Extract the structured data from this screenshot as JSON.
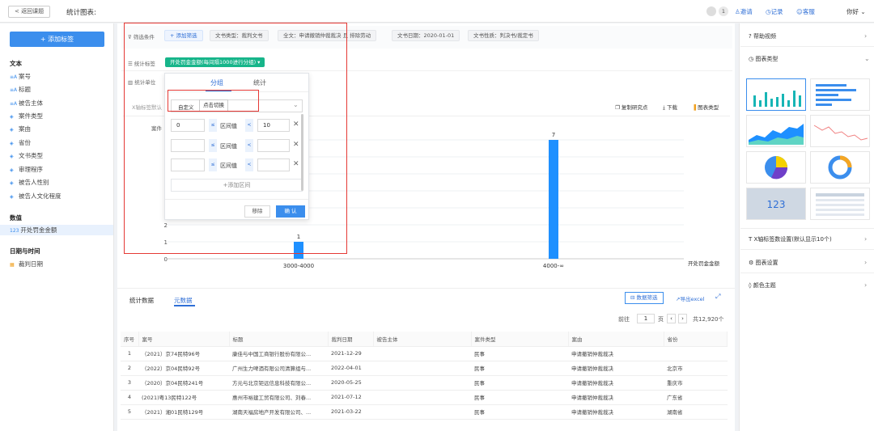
{
  "topbar": {
    "back_label": "< 返回课题",
    "title": "统计图表:",
    "badge_count": "1",
    "invite": "邀请",
    "record": "记录",
    "service": "客服",
    "user": "你好"
  },
  "sidebar": {
    "add_label": "+ 添加标签",
    "groups": [
      {
        "title": "文本",
        "items": [
          "案号",
          "标题",
          "被告主体",
          "案件类型",
          "案由",
          "省份",
          "文书类型",
          "审理程序",
          "被告人性别",
          "被告人文化程度"
        ]
      },
      {
        "title": "数值",
        "items": [
          "开处罚金金额"
        ]
      },
      {
        "title": "日期与时间",
        "items": [
          "裁判日期"
        ]
      }
    ]
  },
  "filters": {
    "label": "筛选条件",
    "add": "+ 添加筛选",
    "chips": [
      "文书类型：裁判文书",
      "全文：申请撤销仲裁裁决 且 排除劳动",
      "文书日期：2020-01-01",
      "文书性质：判决书/裁定书"
    ]
  },
  "stat": {
    "tag_label": "统计标签",
    "tag_value": "开处罚金金额(每间隔1000进行分组) ▾",
    "unit_label": "统计单位",
    "x_label": "X轴标签默认"
  },
  "popover": {
    "tab_group": "分组",
    "tab_stat": "统计",
    "custom": "自定义",
    "click_switch": "点击切换",
    "range_text": "区间值",
    "rows": [
      {
        "from": "0",
        "to": "10"
      },
      {
        "from": "",
        "to": ""
      },
      {
        "from": "",
        "to": ""
      }
    ],
    "add_range": "+添加区间",
    "remove": "移除",
    "ok": "确 认"
  },
  "toolbar": {
    "copy": "复制研究点",
    "download": "下载",
    "chart_type": "图表类型"
  },
  "chart_data": {
    "type": "bar",
    "categories": [
      "3000-4000",
      "4000-∞"
    ],
    "values": [
      1,
      7
    ],
    "ylabel": "案件",
    "xlabel": "开处罚金金额",
    "yticks": [
      "0",
      "1",
      "2"
    ],
    "bar_color": "#1e90ff"
  },
  "table": {
    "tab_stats": "统计数据",
    "tab_meta": "元数据",
    "filter_btn": "数据筛选",
    "export_btn": "导出excel",
    "pager": {
      "prev": "前往",
      "page": "1",
      "unit": "页",
      "total": "共12,920个"
    },
    "columns": [
      "序号",
      "案号",
      "标题",
      "裁判日期",
      "被告主体",
      "案件类型",
      "案由",
      "省份"
    ],
    "rows": [
      [
        "1",
        "（2021）京74民特96号",
        "康佳与中国工商银行股份有限公...",
        "2021-12-29",
        "",
        "民事",
        "申请撤销仲裁裁决",
        ""
      ],
      [
        "2",
        "（2022）京04民特92号",
        "广州生力啤酒有限公司清算组与...",
        "2022-04-01",
        "",
        "民事",
        "申请撤销仲裁裁决",
        "北京市"
      ],
      [
        "3",
        "（2020）京04民特241号",
        "方元与北京钜远信息科技有限公...",
        "2020-05-25",
        "",
        "民事",
        "申请撤销仲裁裁决",
        "重庆市"
      ],
      [
        "4",
        "(2021)粤13民特122号",
        "惠州市裕建工贸有限公司、刘春...",
        "2021-07-12",
        "",
        "民事",
        "申请撤销仲裁裁决",
        "广东省"
      ],
      [
        "5",
        "（2021）湘01民特129号",
        "湖南天福房地产开发有限公司、...",
        "2021-03-22",
        "",
        "民事",
        "申请撤销仲裁裁决",
        "湖南省"
      ]
    ]
  },
  "right_panel": {
    "help": "帮助视频",
    "chart_type": "图表类型",
    "number_tile": "123",
    "x_setting": "X轴标签数设置(默认显示10个)",
    "chart_setting": "图表设置",
    "color_theme": "颜色主题"
  }
}
